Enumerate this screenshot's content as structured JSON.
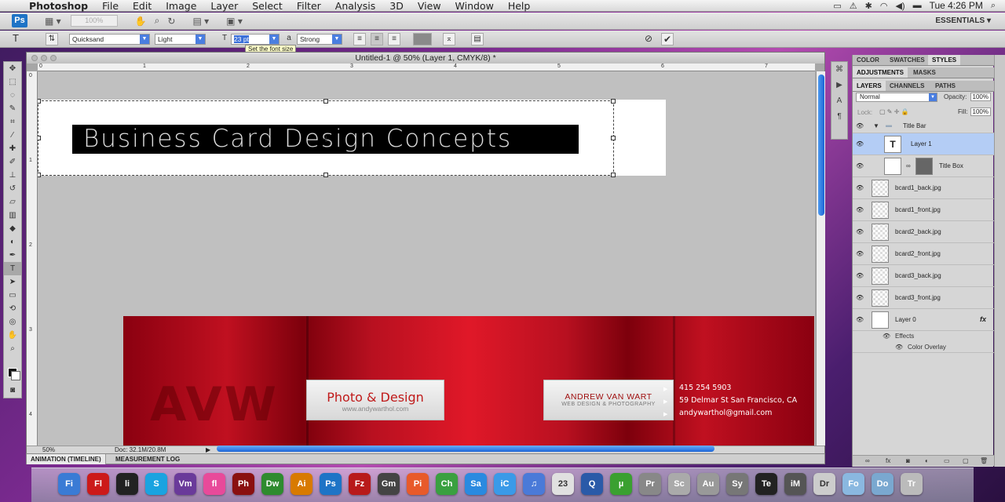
{
  "menubar": {
    "app_name": "Photoshop",
    "items": [
      "File",
      "Edit",
      "Image",
      "Layer",
      "Select",
      "Filter",
      "Analysis",
      "3D",
      "View",
      "Window",
      "Help"
    ],
    "clock": "Tue 4:26 PM"
  },
  "appbar": {
    "logo": "Ps",
    "zoom": "100%",
    "workspace": "ESSENTIALS"
  },
  "options": {
    "font_family": "Quicksand",
    "font_style": "Light",
    "font_size": "23 pt",
    "antialias": "Strong",
    "tooltip": "Set the font size"
  },
  "document": {
    "title": "Untitled-1 @ 50% (Layer 1, CMYK/8) *",
    "zoom_readout": "50%",
    "doc_size": "Doc: 32.1M/20.8M",
    "ruler_top": [
      "0",
      "1",
      "2",
      "3",
      "4",
      "5",
      "6",
      "7"
    ],
    "ruler_left": [
      "0",
      "1",
      "2",
      "3",
      "4"
    ]
  },
  "canvas": {
    "title_text": "Business Card Design Concepts",
    "watermark": "AVW",
    "card_photo_title": "Photo & Design",
    "card_photo_url": "www.andywarthol.com",
    "card_name": "ANDREW VAN WART",
    "card_subtitle": "WEB DESIGN & PHOTOGRAPHY",
    "phone": "415 254 5903",
    "address": "59 Delmar St   San Francisco, CA",
    "email": "andywarthol@gmail.com"
  },
  "timeline": {
    "tabs": [
      "ANIMATION (TIMELINE)",
      "MEASUREMENT LOG"
    ]
  },
  "panels": {
    "top_tabs": [
      "COLOR",
      "SWATCHES",
      "STYLES"
    ],
    "mid_tabs": [
      "ADJUSTMENTS",
      "MASKS"
    ],
    "layer_tabs": [
      "LAYERS",
      "CHANNELS",
      "PATHS"
    ],
    "blend_mode": "Normal",
    "opacity_label": "Opacity:",
    "opacity": "100%",
    "lock_label": "Lock:",
    "fill_label": "Fill:",
    "fill": "100%",
    "layers": [
      {
        "name": "Title Bar",
        "kind": "group"
      },
      {
        "name": "Layer 1",
        "kind": "type",
        "selected": true
      },
      {
        "name": "Title Box",
        "kind": "masked"
      },
      {
        "name": "bcard1_back.jpg",
        "kind": "image"
      },
      {
        "name": "bcard1_front.jpg",
        "kind": "image"
      },
      {
        "name": "bcard2_back.jpg",
        "kind": "image"
      },
      {
        "name": "bcard2_front.jpg",
        "kind": "image"
      },
      {
        "name": "bcard3_back.jpg",
        "kind": "image"
      },
      {
        "name": "bcard3_front.jpg",
        "kind": "image"
      },
      {
        "name": "Layer 0",
        "kind": "white",
        "fx": "fx"
      }
    ],
    "effects_label": "Effects",
    "effect_item": "Color Overlay"
  },
  "colors": {
    "accent_blue": "#1b66d6",
    "card_red": "#c01020",
    "selected_layer": "#b4cdf5"
  },
  "dock": {
    "apps": [
      {
        "label": "Fi",
        "color": "#3a7bd5",
        "icon": "finder-icon"
      },
      {
        "label": "Fl",
        "color": "#cc1a1a",
        "icon": "flash-icon"
      },
      {
        "label": "li",
        "color": "#222222",
        "icon": "live-icon"
      },
      {
        "label": "S",
        "color": "#1aa3e0",
        "icon": "skype-icon"
      },
      {
        "label": "Vm",
        "color": "#6a3a9a",
        "icon": "vmware-icon"
      },
      {
        "label": "fl",
        "color": "#e84a9a",
        "icon": "flickr-uploader-icon"
      },
      {
        "label": "Ph",
        "color": "#8a1010",
        "icon": "photo-booth-icon"
      },
      {
        "label": "Dw",
        "color": "#2e8b2e",
        "icon": "dreamweaver-icon"
      },
      {
        "label": "Ai",
        "color": "#d87a00",
        "icon": "illustrator-icon"
      },
      {
        "label": "Ps",
        "color": "#1e74c6",
        "icon": "photoshop-icon"
      },
      {
        "label": "Fz",
        "color": "#b81a1a",
        "icon": "filezilla-icon"
      },
      {
        "label": "Gm",
        "color": "#444444",
        "icon": "gamma-icon"
      },
      {
        "label": "Pi",
        "color": "#e85a2a",
        "icon": "pinwheel-icon"
      },
      {
        "label": "Ch",
        "color": "#3aa040",
        "icon": "chrome-icon"
      },
      {
        "label": "Sa",
        "color": "#2a8ae0",
        "icon": "safari-icon"
      },
      {
        "label": "iC",
        "color": "#3a9ae8",
        "icon": "ichat-icon"
      },
      {
        "label": "♫",
        "color": "#4a7ad8",
        "icon": "itunes-icon"
      },
      {
        "label": "23",
        "color": "#e0e0e0",
        "icon": "calendar-icon"
      },
      {
        "label": "Q",
        "color": "#2a5aa8",
        "icon": "quicktime-icon"
      },
      {
        "label": "µ",
        "color": "#3aa030",
        "icon": "utorrent-icon"
      },
      {
        "label": "Pr",
        "color": "#888888",
        "icon": "preview-icon"
      },
      {
        "label": "Sc",
        "color": "#aaaaaa",
        "icon": "script-icon"
      },
      {
        "label": "Au",
        "color": "#999999",
        "icon": "automator-icon"
      },
      {
        "label": "Sy",
        "color": "#777777",
        "icon": "system-prefs-icon"
      },
      {
        "label": "Te",
        "color": "#222222",
        "icon": "terminal-icon"
      },
      {
        "label": "iM",
        "color": "#555555",
        "icon": "imovie-icon"
      },
      {
        "label": "Dr",
        "color": "#cccccc",
        "icon": "drive-icon"
      },
      {
        "label": "Fo",
        "color": "#8ab8e0",
        "icon": "folder-icon"
      },
      {
        "label": "Do",
        "color": "#7aa8d0",
        "icon": "downloads-icon"
      },
      {
        "label": "Tr",
        "color": "#bbbbbb",
        "icon": "trash-icon"
      }
    ]
  }
}
